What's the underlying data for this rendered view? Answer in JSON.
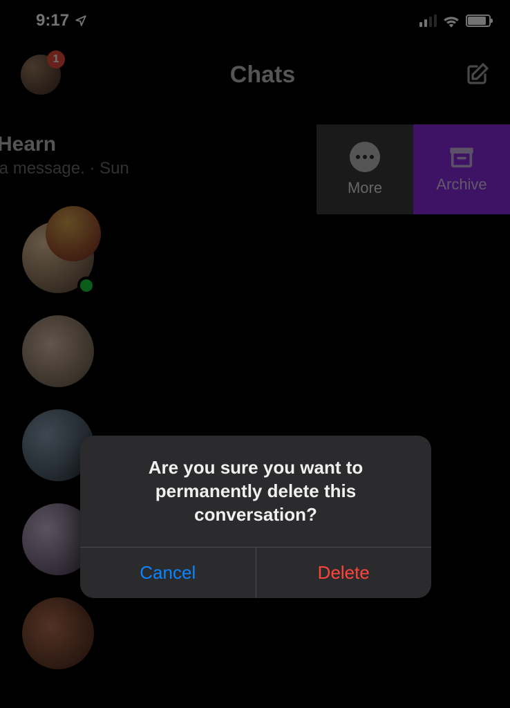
{
  "status": {
    "time": "9:17",
    "location_arrow": "location-arrow-icon",
    "signal_bars_filled": 2,
    "wifi": "wifi-icon",
    "battery_percent_approx": 80
  },
  "header": {
    "title": "Chats",
    "badge_count": "1",
    "compose": "compose-icon"
  },
  "chat_preview": {
    "name": "Hearn",
    "subtitle": "nt a message. · Sun"
  },
  "swipe_actions": {
    "more_label": "More",
    "archive_label": "Archive"
  },
  "avatars": [
    {
      "class": "g1",
      "online": true
    },
    {
      "class": "g4",
      "online": false
    },
    {
      "class": "g2",
      "online": false
    },
    {
      "class": "g3",
      "online": false
    },
    {
      "class": "g5",
      "online": false
    }
  ],
  "dialog": {
    "message": "Are you sure you want to permanently delete this conversation?",
    "cancel": "Cancel",
    "delete": "Delete"
  },
  "colors": {
    "archive_purple": "#8a2be2",
    "badge_red": "#e74c3c",
    "online_green": "#18cc3a",
    "ios_blue": "#0A84FF",
    "ios_red": "#ff453a"
  }
}
